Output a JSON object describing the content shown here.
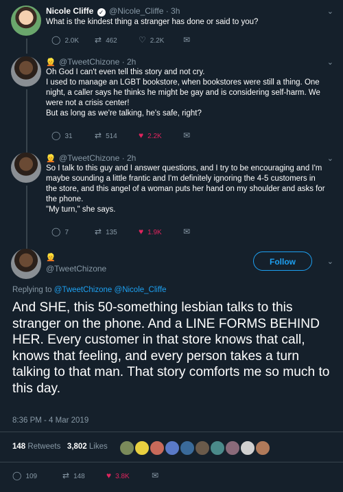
{
  "tweet1": {
    "name": "Nicole Cliffe",
    "handle": "@Nicole_Cliffe",
    "time": "· 3h",
    "text": "What is the kindest thing a stranger has done or said to you?",
    "replies": "2.0K",
    "retweets": "462",
    "likes": "2.2K"
  },
  "tweet2": {
    "handle": "@TweetChizone",
    "time": "· 2h",
    "lines": [
      "Oh God I can't even tell this story and not cry.",
      "I used to manage an LGBT bookstore, when bookstores were still a thing. One",
      "night, a caller says he thinks he might be gay and is considering self-harm. We",
      "were not a crisis center!",
      "But as long as we're talking, he's safe, right?"
    ],
    "replies": "31",
    "retweets": "514",
    "likes": "2.2K"
  },
  "tweet3": {
    "handle": "@TweetChizone",
    "time": "· 2h",
    "lines": [
      "So I talk to this guy and I answer questions, and I try to be encouraging and I'm",
      "maybe sounding a little frantic and I'm definitely ignoring the 4-5 customers in",
      "the store, and this angel of a woman puts her hand on my shoulder and asks for",
      "the phone.",
      "\"My turn,\" she says."
    ],
    "replies": "7",
    "retweets": "135",
    "likes": "1.9K"
  },
  "main_tweet": {
    "handle": "@TweetChizone",
    "follow_label": "Follow",
    "replying_prefix": "Replying to",
    "replying_to_1": "@TweetChizone",
    "replying_to_2": "@Nicole_Cliffe",
    "text": "And SHE, this 50-something lesbian talks to this stranger on the phone. And a LINE FORMS BEHIND HER. Every customer in that store knows that call, knows that feeling, and every person takes a turn talking to that man. That story comforts me so much to this day.",
    "timestamp": "8:36 PM - 4 Mar 2019",
    "retweet_count": "148",
    "retweets_label": "Retweets",
    "like_count": "3,802",
    "likes_label": "Likes",
    "replies": "109",
    "retweets": "148",
    "likes": "3.8K"
  },
  "colors": {
    "background": "#15202b",
    "accent": "#1da1f2",
    "like_red": "#e0245e",
    "muted": "#8899a6"
  }
}
